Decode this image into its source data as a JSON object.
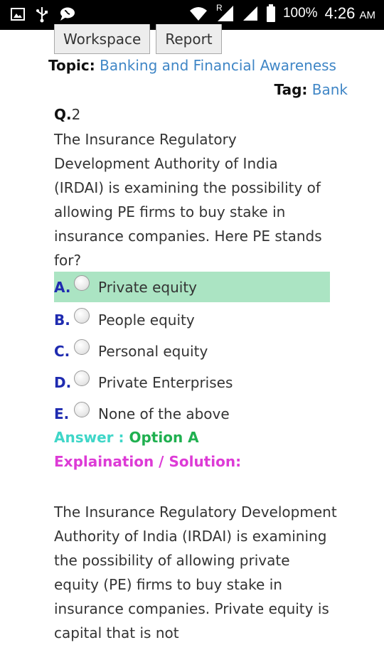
{
  "status_bar": {
    "battery": "100%",
    "time": "4:26",
    "ampm": "AM",
    "signal_label": "R"
  },
  "buttons": {
    "workspace": "Workspace",
    "report": "Report"
  },
  "topic": {
    "label": "Topic:",
    "value": "Banking and Financial Awareness"
  },
  "tag": {
    "label": "Tag:",
    "value": "Bank"
  },
  "question": {
    "number_label": "Q.",
    "number": "2",
    "text": "The Insurance Regulatory Development Authority of India (IRDAI) is examining the possibility of allowing PE firms to buy stake in insurance companies. Here PE stands for?"
  },
  "options": [
    {
      "letter": "A.",
      "text": "Private equity",
      "correct": true
    },
    {
      "letter": "B.",
      "text": "People equity",
      "correct": false
    },
    {
      "letter": "C.",
      "text": "Personal equity",
      "correct": false
    },
    {
      "letter": "D.",
      "text": "Private Enterprises",
      "correct": false
    },
    {
      "letter": "E.",
      "text": "None of the above",
      "correct": false
    }
  ],
  "answer": {
    "label": "Answer :",
    "value": "Option A"
  },
  "explanation_label": "Explaination / Solution:",
  "solution_text": "The Insurance Regulatory Development Authority of India (IRDAI) is examining the possibility of allowing private equity (PE) firms to buy stake in insurance companies. Private equity is capital that is not",
  "colors": {
    "correct_bg": "#abe4c3",
    "link": "#3f86c6",
    "option_letter": "#1f2bb0",
    "answer_label": "#3fd6c8",
    "answer_value": "#20b050",
    "explanation": "#dd3bd6"
  }
}
